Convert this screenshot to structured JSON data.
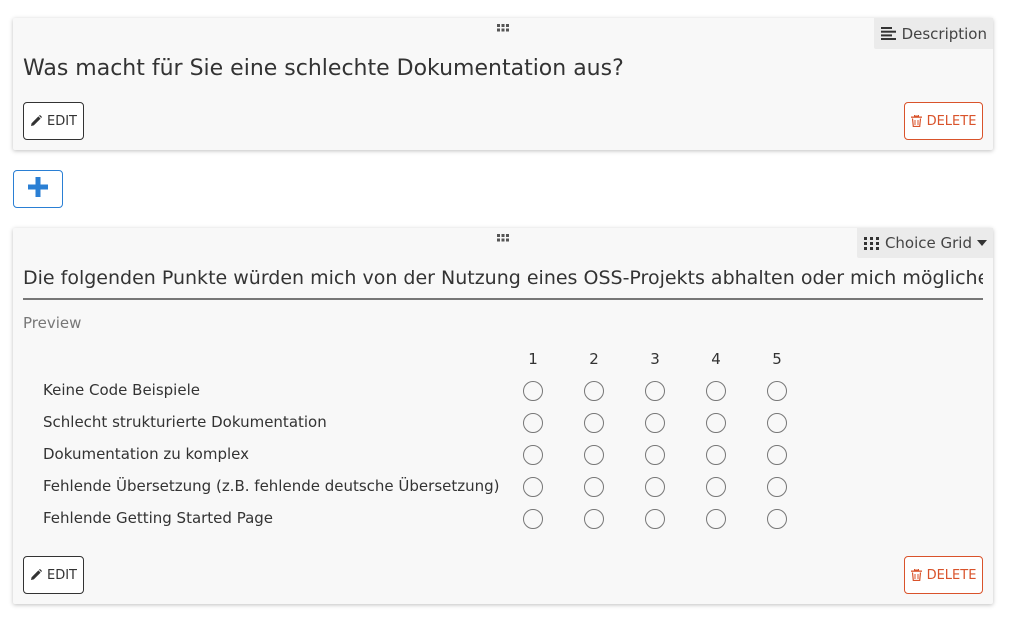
{
  "card1": {
    "type_label": "Description",
    "type_icon": "align-left-icon",
    "question_title": "Was macht für Sie eine schlechte Dokumentation aus?",
    "edit_label": "EDIT",
    "delete_label": "DELETE"
  },
  "add_button": {
    "icon": "plus-icon",
    "color": "#2a7fd4"
  },
  "card2": {
    "type_label": "Choice Grid",
    "type_icon": "grid-icon",
    "question_value": "Die folgenden Punkte würden mich von der Nutzung eines OSS-Projekts abhalten oder mich möglicherweise",
    "preview_label": "Preview",
    "columns": [
      "1",
      "2",
      "3",
      "4",
      "5"
    ],
    "rows": [
      "Keine Code Beispiele",
      "Schlecht strukturierte Dokumentation",
      "Dokumentation zu komplex",
      "Fehlende Übersetzung (z.B. fehlende deutsche Übersetzung)",
      "Fehlende Getting Started Page"
    ],
    "edit_label": "EDIT",
    "delete_label": "DELETE"
  },
  "colors": {
    "delete": "#d9532b",
    "accent": "#2a7fd4",
    "card_bg": "#f8f8f8"
  }
}
